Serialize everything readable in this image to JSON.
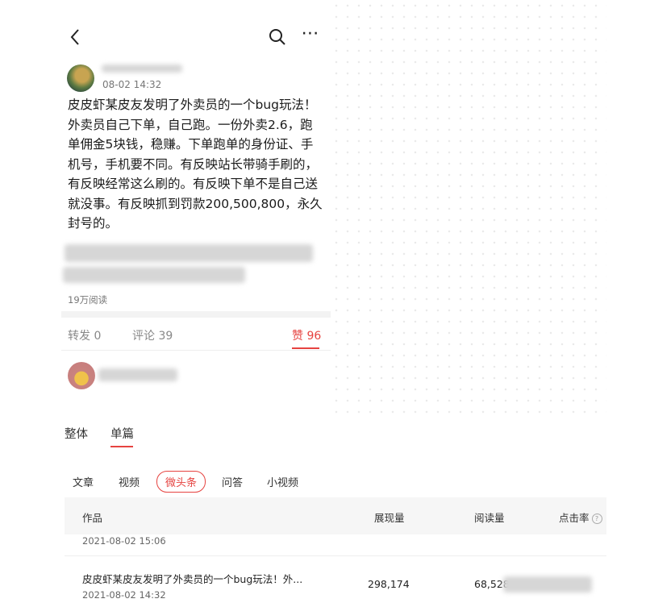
{
  "post": {
    "time": "08-02 14:32",
    "content": "皮皮虾某皮友发明了外卖员的一个bug玩法！外卖员自己下单，自己跑。一份外卖2.6，跑单佣金5块钱，稳赚。下单跑单的身份证、手机号，手机要不同。有反映站长带骑手刷的，有反映经常这么刷的。有反映下单不是自己送就没事。有反映抓到罚款200,500,800，永久封号的。",
    "reads": "19万阅读",
    "reposts_label": "转发 0",
    "comments_label": "评论 39",
    "likes_label": "赞 96"
  },
  "icons": {
    "back": "back-arrow-icon",
    "search": "search-icon",
    "more": "more-icon",
    "help": "question-circle-icon"
  },
  "stats_tabs": [
    {
      "label": "整体"
    },
    {
      "label": "单篇",
      "active": true
    }
  ],
  "categories": [
    {
      "label": "文章"
    },
    {
      "label": "视频"
    },
    {
      "label": "微头条",
      "active": true
    },
    {
      "label": "问答"
    },
    {
      "label": "小视频"
    }
  ],
  "table": {
    "headers": {
      "work": "作品",
      "impressions": "展现量",
      "reads": "阅读量",
      "ctr": "点击率"
    },
    "partial_row_date": "2021-08-02 15:06",
    "rows": [
      {
        "title": "皮皮虾某皮友发明了外卖员的一个bug玩法！外...",
        "date": "2021-08-02 14:32",
        "impressions": "298,174",
        "reads": "68,528"
      }
    ]
  },
  "colors": {
    "accent": "#e64340",
    "muted": "#888888"
  }
}
